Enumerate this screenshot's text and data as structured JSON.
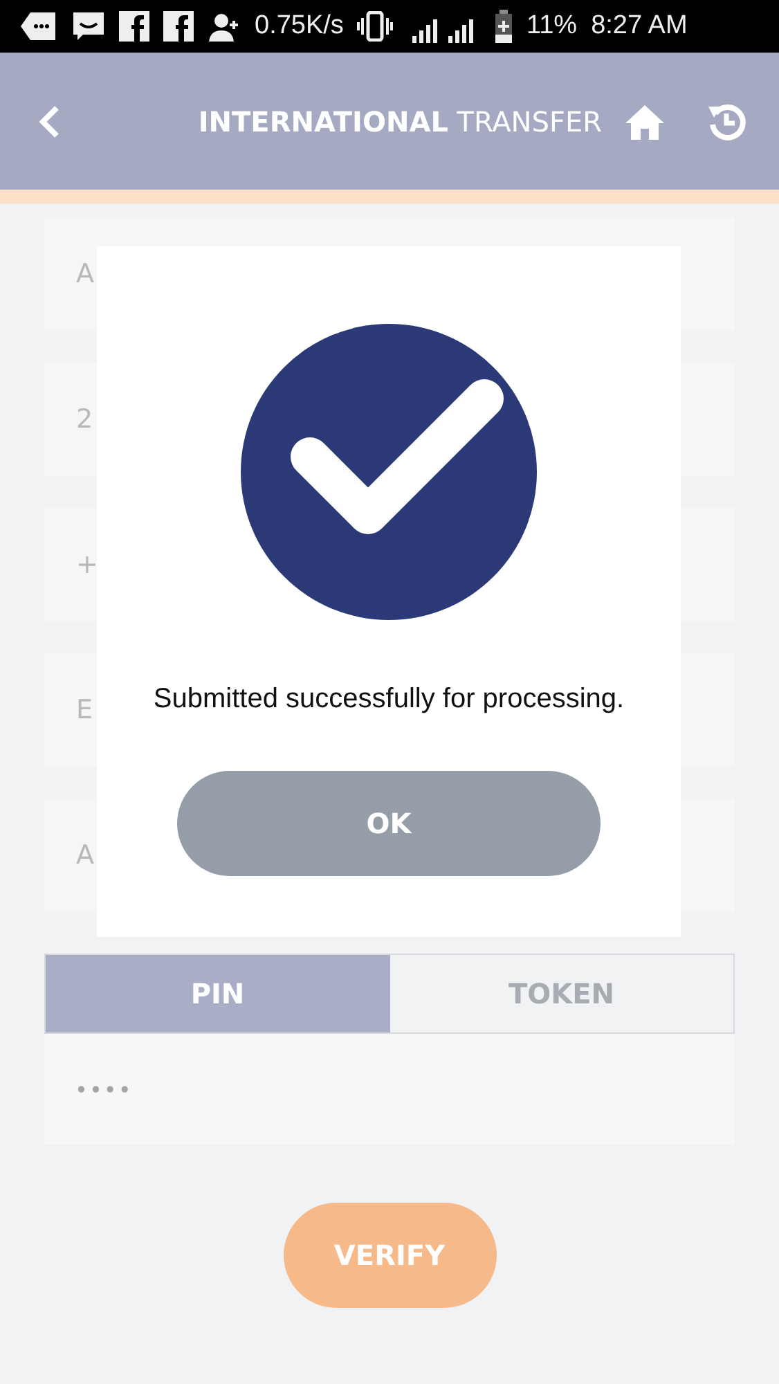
{
  "status_bar": {
    "speed": "0.75K/s",
    "battery": "11%",
    "time": "8:27 AM"
  },
  "header": {
    "title_bold": "INTERNATIONAL",
    "title_rest": "TRANSFER"
  },
  "form_fields": [
    {
      "value": "A"
    },
    {
      "value": "2"
    },
    {
      "value": "+"
    },
    {
      "value": "E"
    },
    {
      "value": "A"
    }
  ],
  "auth_tabs": [
    {
      "label": "PIN",
      "selected": true
    },
    {
      "label": "TOKEN",
      "selected": false
    }
  ],
  "pin_field": {
    "value": "••••"
  },
  "verify_button": "VERIFY",
  "dialog": {
    "message": "Submitted successfully for processing.",
    "ok_button": "OK"
  }
}
